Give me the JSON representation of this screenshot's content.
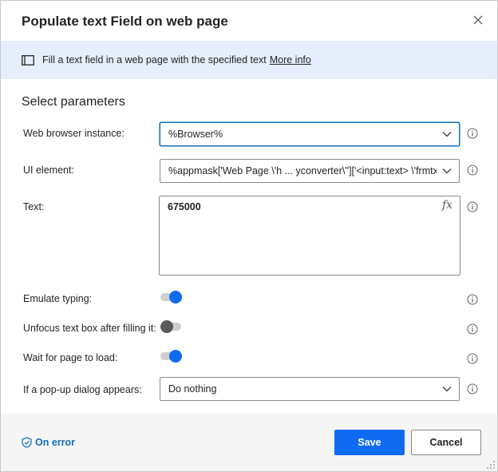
{
  "dialog": {
    "title": "Populate text Field on web page",
    "close_icon": "close-icon"
  },
  "info_bar": {
    "icon": "panel-icon",
    "description": "Fill a text field in a web page with the specified text",
    "more_info": "More info"
  },
  "section_title": "Select parameters",
  "params": {
    "browser": {
      "label": "Web browser instance:",
      "value": "%Browser%"
    },
    "ui_element": {
      "label": "UI element:",
      "value": "%appmask['Web Page \\'h ... yconverter\\'']['<input:text> \\'frmtx"
    },
    "text": {
      "label": "Text:",
      "value": "675000",
      "fx": "fx"
    },
    "emulate_typing": {
      "label": "Emulate typing:",
      "on": true
    },
    "unfocus": {
      "label": "Unfocus text box after filling it:",
      "on": false
    },
    "wait_load": {
      "label": "Wait for page to load:",
      "on": true
    },
    "popup": {
      "label": "If a pop-up dialog appears:",
      "value": "Do nothing"
    }
  },
  "footer": {
    "on_error": "On error",
    "save": "Save",
    "cancel": "Cancel"
  },
  "colors": {
    "accent": "#0f6cf0",
    "info_bar_bg": "#e6eefb",
    "footer_bg": "#f5f5f5"
  }
}
